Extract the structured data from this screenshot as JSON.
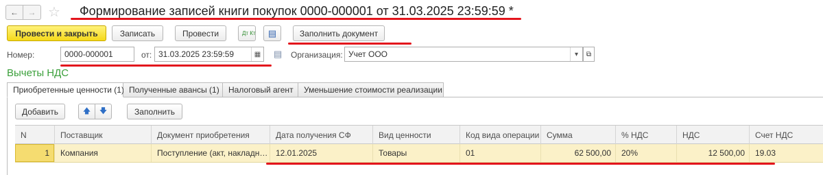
{
  "nav": {
    "back_icon": "←",
    "forward_icon": "→",
    "star_icon": "☆"
  },
  "title": "Формирование записей книги покупок 0000-000001 от 31.03.2025 23:59:59 *",
  "toolbar": {
    "post_close": "Провести и закрыть",
    "save": "Записать",
    "post": "Провести",
    "dt_kt_icon": "Дт Кт",
    "report_icon": "▤",
    "fill_document": "Заполнить документ"
  },
  "form": {
    "number_label": "Номер:",
    "number_value": "0000-000001",
    "date_label": "от:",
    "date_value": "31.03.2025 23:59:59",
    "org_label": "Организация:",
    "org_value": "Учет ООО",
    "calendar_icon": "▦",
    "dropdown_icon": "▾",
    "open_icon": "⧉",
    "memo_icon": "▤"
  },
  "section_title": "Вычеты НДС",
  "tabs": [
    {
      "label": "Приобретенные ценности (1)"
    },
    {
      "label": "Полученные авансы (1)"
    },
    {
      "label": "Налоговый агент"
    },
    {
      "label": "Уменьшение стоимости реализации"
    }
  ],
  "table_toolbar": {
    "add": "Добавить",
    "up_icon": "🡅",
    "down_icon": "🡇",
    "fill": "Заполнить"
  },
  "table": {
    "columns": [
      "N",
      "Поставщик",
      "Документ приобретения",
      "Дата получения СФ",
      "Вид ценности",
      "Код вида операции",
      "Сумма",
      "% НДС",
      "НДС",
      "Счет НДС"
    ],
    "rows": [
      [
        "1",
        "Компания",
        "Поступление (акт, накладн…",
        "12.01.2025",
        "Товары",
        "01",
        "62 500,00",
        "20%",
        "12 500,00",
        "19.03"
      ]
    ]
  },
  "colors": {
    "accent_green": "#3a9f3a",
    "primary_button": "#f5d91a",
    "selected_row": "#fbf1c8",
    "markup_red": "#e3141c"
  }
}
